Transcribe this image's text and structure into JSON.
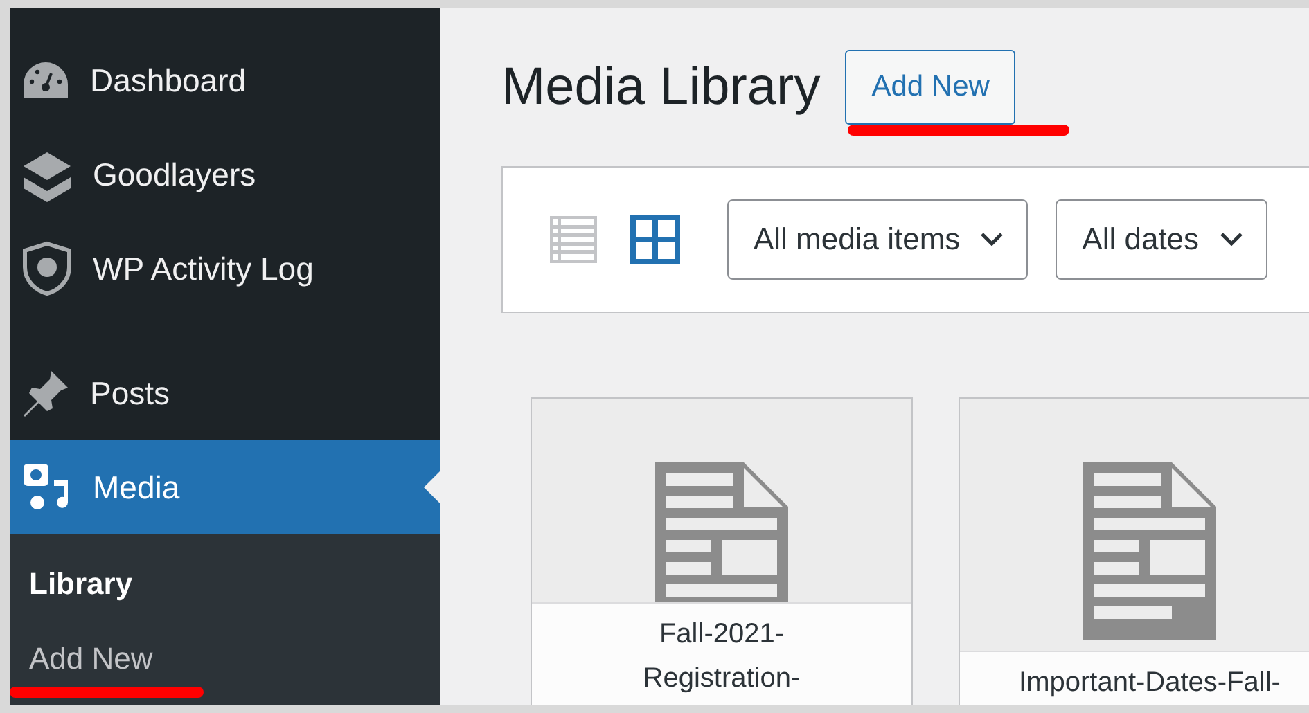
{
  "sidebar": {
    "groups": [
      [
        {
          "label": "Dashboard",
          "selected": false
        },
        {
          "label": "Goodlayers",
          "selected": false
        },
        {
          "label": "WP Activity Log",
          "selected": false
        }
      ],
      [
        {
          "label": "Posts",
          "selected": false
        },
        {
          "label": "Media",
          "selected": true
        }
      ]
    ],
    "submenu": [
      {
        "label": "Library",
        "selected": true,
        "underlined": false
      },
      {
        "label": "Add New",
        "selected": false,
        "underlined": true
      }
    ]
  },
  "header": {
    "title": "Media Library",
    "button": {
      "label": "Add New",
      "underlined": true
    }
  },
  "toolbar": {
    "views": [
      {
        "selected": false
      },
      {
        "selected": true
      }
    ],
    "filters": [
      {
        "value": "All media items"
      },
      {
        "value": "All dates"
      }
    ]
  },
  "attachments": [
    {
      "caption_lines": [
        "Fall-2021-",
        "Registration-"
      ]
    },
    {
      "caption_lines": [
        "Important-Dates-Fall-"
      ]
    }
  ]
}
